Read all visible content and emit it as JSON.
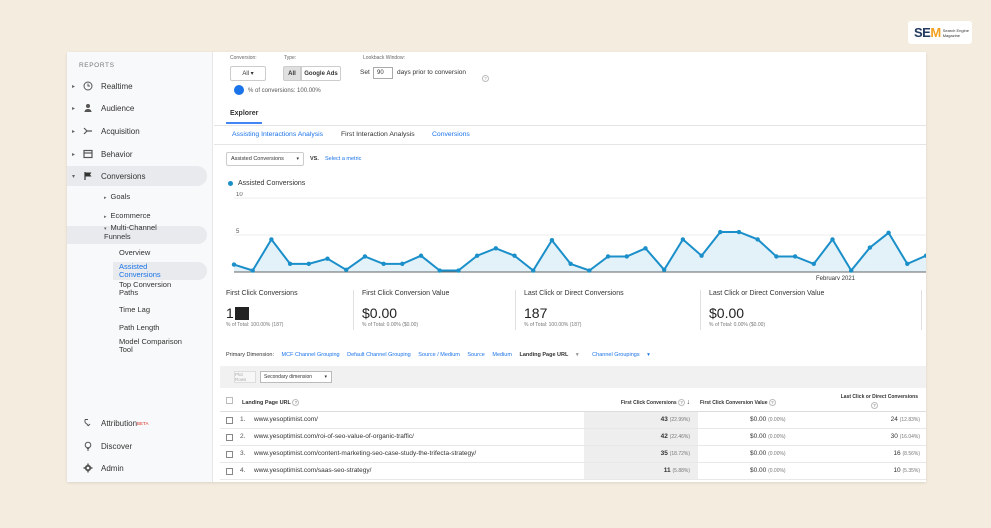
{
  "brand": {
    "name_main": "SE",
    "name_accent": "M",
    "tagline_1": "Search Engine",
    "tagline_2": "Magazine"
  },
  "sidebar": {
    "heading": "REPORTS",
    "items": [
      {
        "label": "Realtime",
        "icon": "clock-icon"
      },
      {
        "label": "Audience",
        "icon": "person-icon"
      },
      {
        "label": "Acquisition",
        "icon": "acquisition-icon"
      },
      {
        "label": "Behavior",
        "icon": "behavior-icon"
      },
      {
        "label": "Conversions",
        "icon": "flag-icon"
      }
    ],
    "sub_items": {
      "goals": "Goals",
      "ecommerce": "Ecommerce",
      "mcf": "Multi-Channel Funnels"
    },
    "leaves": {
      "overview": "Overview",
      "assisted": "Assisted Conversions",
      "top_paths": "Top Conversion Paths",
      "time_lag": "Time Lag",
      "path_length": "Path Length",
      "model_tool": "Model Comparison Tool"
    },
    "bottom": {
      "attribution": "Attribution",
      "beta": "BETA",
      "discover": "Discover",
      "admin": "Admin"
    }
  },
  "controls": {
    "conversion_label": "Conversion:",
    "conversion_value": "All",
    "type_label": "Type:",
    "type_all": "All",
    "type_ads": "Google Ads",
    "lookback_label": "Lookback Window:",
    "set_label": "Set",
    "days_value": "90",
    "days_suffix": "days prior to conversion",
    "pct_conv": "% of conversions: 100.00%"
  },
  "explorer": {
    "tab": "Explorer",
    "subtabs": [
      "Assisting Interactions Analysis",
      "First Interaction Analysis",
      "Conversions"
    ],
    "metric": "Assisted Conversions",
    "vs": "VS.",
    "select_metric": "Select a metric"
  },
  "chart_data": {
    "type": "area",
    "series": [
      {
        "name": "Assisted Conversions",
        "color": "#1a8fc9",
        "values": [
          1,
          0.2,
          4.4,
          1.1,
          1.1,
          1.8,
          0.3,
          2.1,
          1.1,
          1.1,
          2.2,
          0.2,
          0.2,
          2.2,
          3.2,
          2.2,
          0.2,
          4.3,
          1.1,
          0.2,
          2.1,
          2.1,
          3.2,
          0.3,
          4.4,
          2.2,
          5.4,
          5.4,
          4.4,
          2.1,
          2.1,
          1.1,
          4.4,
          0.2,
          3.3,
          5.3,
          1.1,
          2.2
        ]
      }
    ],
    "y_ticks": [
      "10",
      "5"
    ],
    "ylim": [
      0,
      10
    ],
    "x_annotation": "February 2021",
    "grid": true
  },
  "scorecards": [
    {
      "title": "First Click Conversions",
      "value": "1",
      "pct": "% of Total: 100.00% (187)"
    },
    {
      "title": "First Click Conversion Value",
      "value": "$0.00",
      "pct": "% of Total: 0.00% ($0.00)"
    },
    {
      "title": "Last Click or Direct Conversions",
      "value": "187",
      "pct": "% of Total: 100.00% (187)"
    },
    {
      "title": "Last Click or Direct Conversion Value",
      "value": "$0.00",
      "pct": "% of Total: 0.00% ($0.00)"
    }
  ],
  "dimensions": {
    "label": "Primary Dimension:",
    "options": [
      "MCF Channel Grouping",
      "Default Channel Grouping",
      "Source / Medium",
      "Source",
      "Medium"
    ],
    "selected": "Landing Page URL",
    "groupings": "Channel Groupings"
  },
  "toolbar": {
    "plot_rows": "Plot Rows",
    "secondary": "Secondary dimension"
  },
  "table": {
    "headers": {
      "url": "Landing Page URL",
      "first": "First Click Conversions",
      "fval": "First Click Conversion Value",
      "last": "Last Click or Direct Conversions"
    },
    "rows": [
      {
        "idx": "1.",
        "url": "www.yesoptimist.com/",
        "first": "43",
        "first_pct": "(22.99%)",
        "fval": "$0.00",
        "fval_pct": "(0.00%)",
        "last": "24",
        "last_pct": "(12.83%)"
      },
      {
        "idx": "2.",
        "url": "www.yesoptimist.com/roi-of-seo-value-of-organic-traffic/",
        "first": "42",
        "first_pct": "(22.46%)",
        "fval": "$0.00",
        "fval_pct": "(0.00%)",
        "last": "30",
        "last_pct": "(16.04%)"
      },
      {
        "idx": "3.",
        "url": "www.yesoptimist.com/content-marketing-seo-case-study-the-trifecta-strategy/",
        "first": "35",
        "first_pct": "(18.72%)",
        "fval": "$0.00",
        "fval_pct": "(0.00%)",
        "last": "16",
        "last_pct": "(8.56%)"
      },
      {
        "idx": "4.",
        "url": "www.yesoptimist.com/saas-seo-strategy/",
        "first": "11",
        "first_pct": "(5.88%)",
        "fval": "$0.00",
        "fval_pct": "(0.00%)",
        "last": "10",
        "last_pct": "(5.35%)"
      }
    ]
  },
  "colors": {
    "accent": "#1a73e8",
    "series": "#1a8fc9",
    "fill": "#e3f1f9"
  }
}
